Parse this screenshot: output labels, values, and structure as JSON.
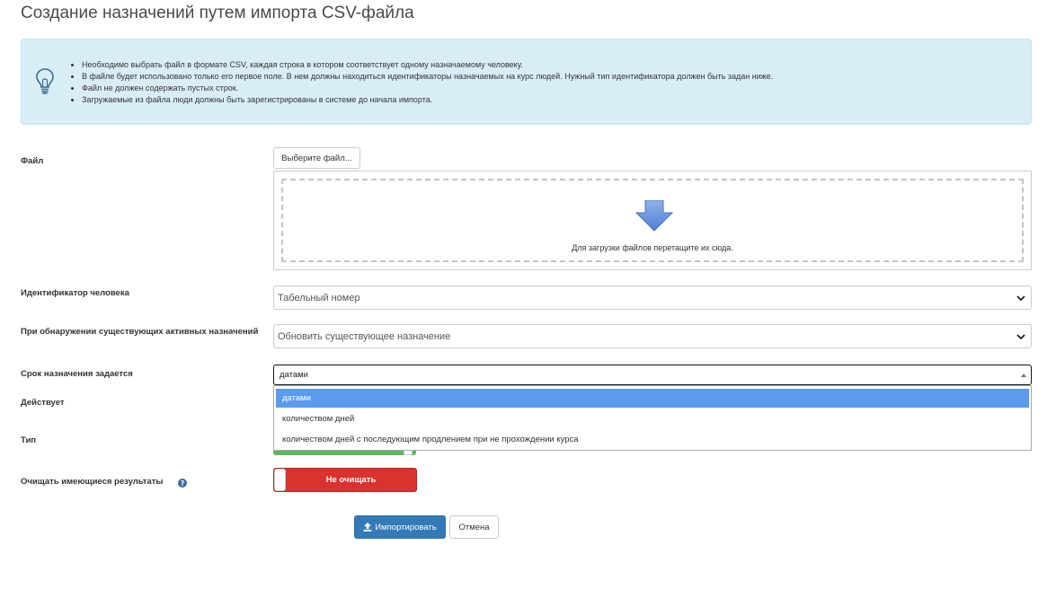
{
  "page": {
    "title": "Создание назначений путем импорта CSV-файла"
  },
  "info": {
    "icon": "lightbulb-icon",
    "items": [
      "Необходимо выбрать файл в формате CSV, каждая строка в котором соответствует одному назначаемому человеку.",
      "В файле будет использовано только его первое поле. В нем должны находиться идентификаторы назначаемых на курс людей. Нужный тип идентификатора должен быть задан ниже.",
      "Файл не должен содержать пустых строк.",
      "Загружаемые из файла люди должны быть зарегистрированы в системе до начала импорта."
    ]
  },
  "form": {
    "file_label": "Файл",
    "file_button": "Выберите файл...",
    "dropzone_text": "Для загрузки файлов перетащите их сюда.",
    "identifier_label": "Идентификатор человека",
    "identifier_value": "Табельный номер",
    "existing_label": "При обнаружении существующих активных назначений",
    "existing_value": "Обновить существующее назначение",
    "term_label": "Срок назначения задается",
    "term_value": "датами",
    "term_options": [
      "датами",
      "количеством дней",
      "количеством дней с последующим продлением при не прохождении курса"
    ],
    "term_selected_index": 0,
    "active_label": "Действует",
    "type_label": "Тип",
    "clear_label": "Очищать имеющиеся результаты",
    "clear_toggle_text": "Не очищать",
    "clear_toggle_on": false
  },
  "actions": {
    "import_label": "Импортировать",
    "cancel_label": "Отмена"
  },
  "colors": {
    "info_bg": "#d9edf7",
    "primary": "#337ab7",
    "danger": "#d9322f",
    "success": "#5cb85c",
    "selected_option": "#5b9bef"
  }
}
